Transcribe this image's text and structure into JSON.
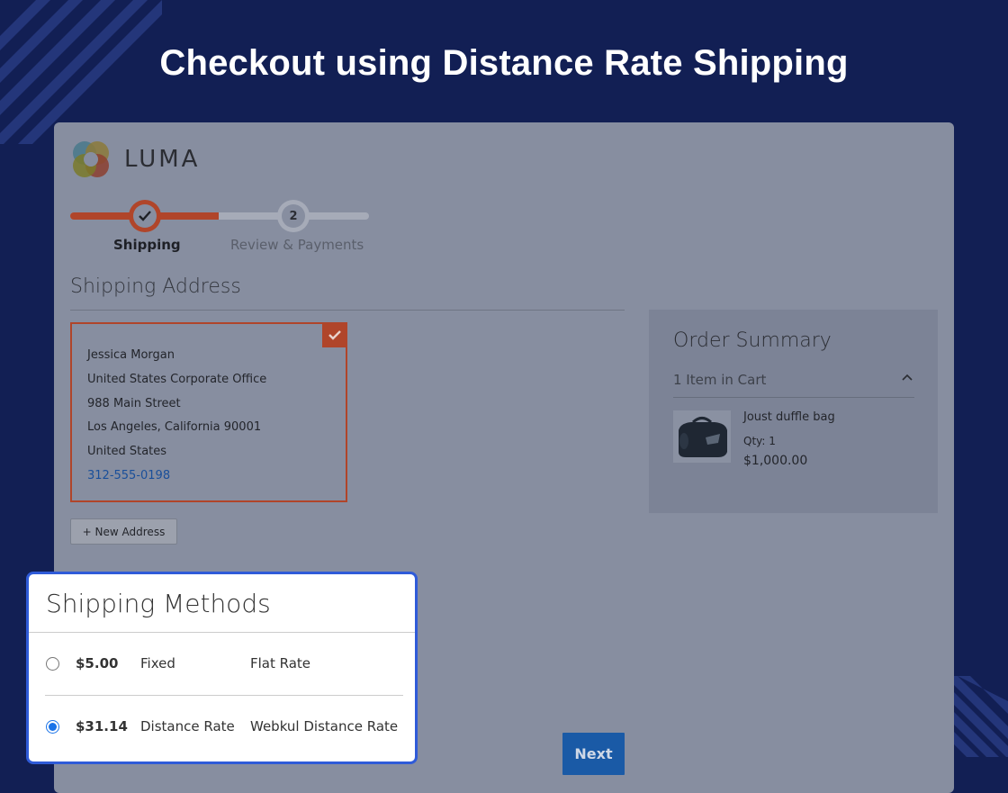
{
  "banner": {
    "title": "Checkout using Distance Rate Shipping"
  },
  "logo": {
    "text": "LUMA"
  },
  "progress": {
    "steps": [
      {
        "number": "1",
        "label": "Shipping",
        "state": "complete"
      },
      {
        "number": "2",
        "label": "Review & Payments",
        "state": "pending"
      }
    ]
  },
  "shipping_address": {
    "title": "Shipping Address",
    "card": {
      "name": "Jessica Morgan",
      "company": "United States Corporate Office",
      "street": "988 Main Street",
      "city_line": "Los Angeles, California 90001",
      "country": "United States",
      "phone": "312-555-0198"
    },
    "new_address_label": "+ New Address"
  },
  "order_summary": {
    "title": "Order Summary",
    "items_label": "1 Item in Cart",
    "product": {
      "name": "Joust duffle bag",
      "qty": "Qty: 1",
      "price": "$1,000.00"
    }
  },
  "shipping_methods": {
    "title": "Shipping Methods",
    "options": [
      {
        "price": "$5.00",
        "type": "Fixed",
        "carrier": "Flat Rate",
        "selected": false
      },
      {
        "price": "$31.14",
        "type": "Distance Rate",
        "carrier": "Webkul Distance Rate",
        "selected": true
      }
    ]
  },
  "actions": {
    "next_label": "Next"
  },
  "colors": {
    "background": "#121f54",
    "accent": "#b0452a",
    "highlight_border": "#2f5bd8",
    "next_button": "#1a5aa6"
  }
}
